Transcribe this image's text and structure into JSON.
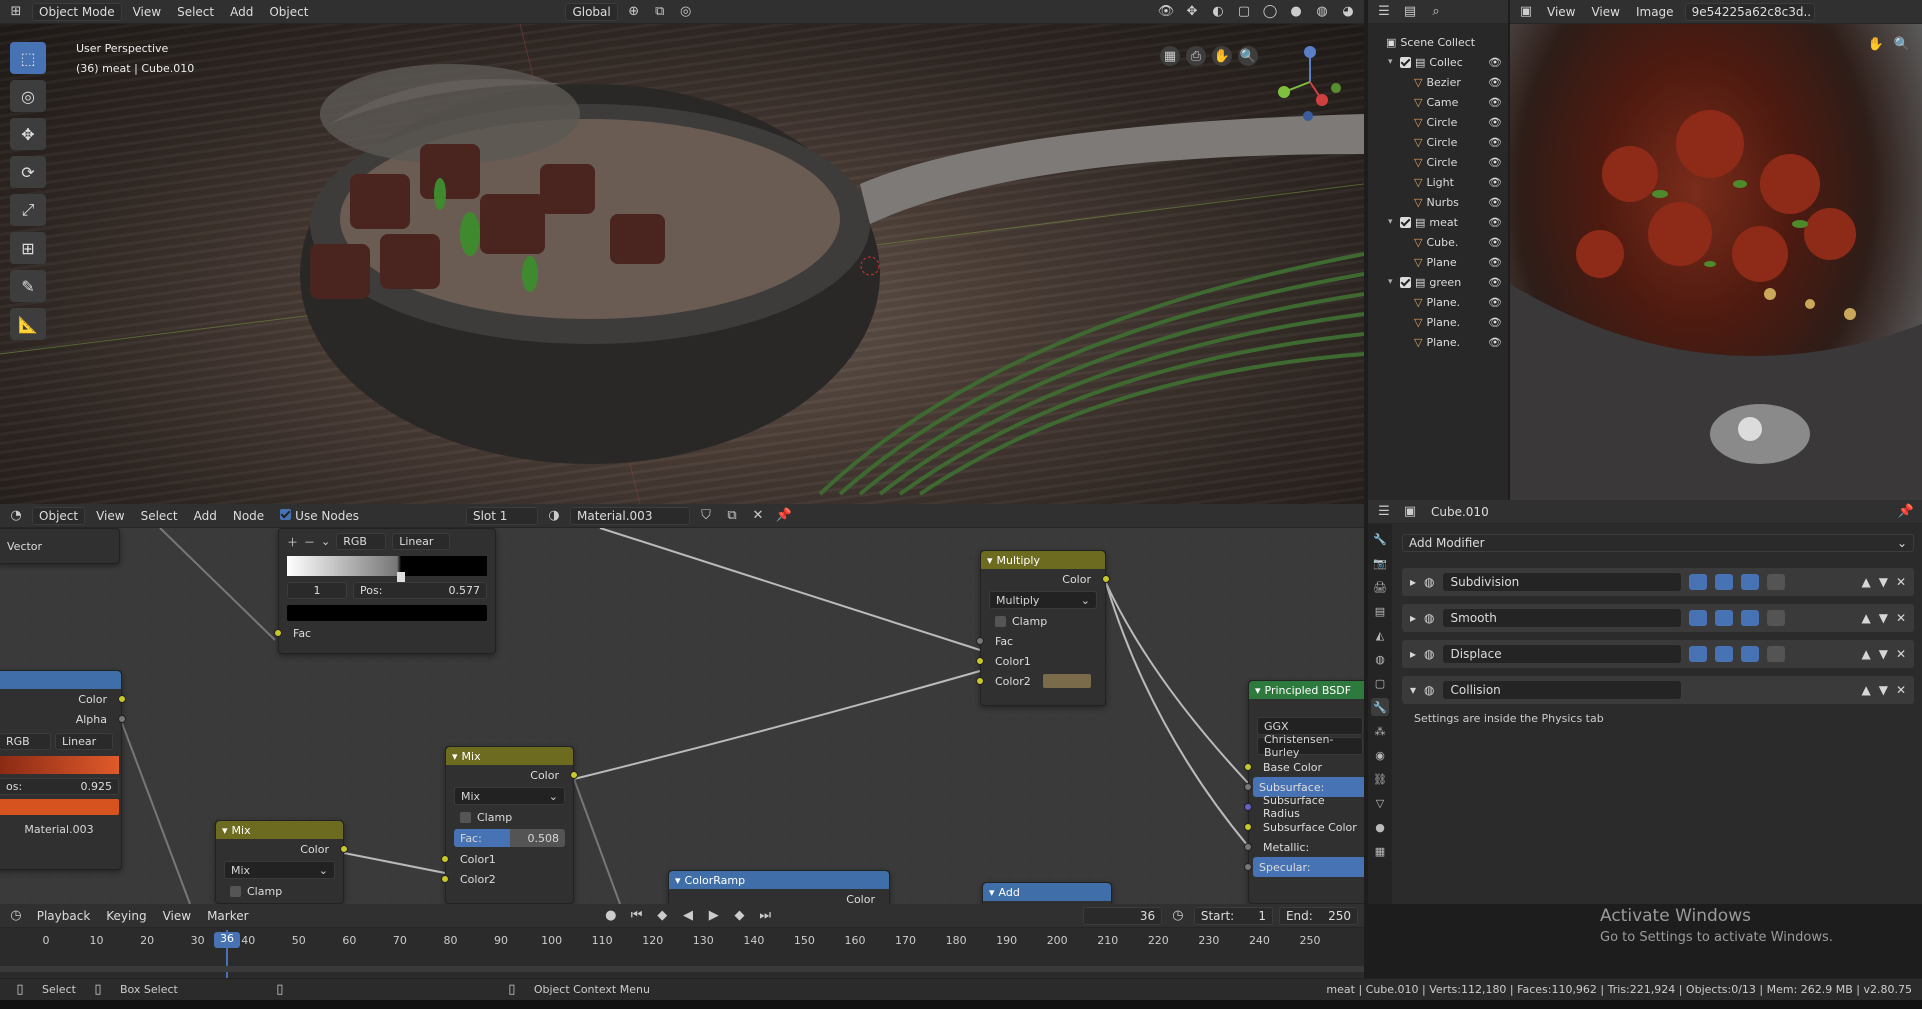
{
  "viewport_header": {
    "mode": "Object Mode",
    "menu": [
      "View",
      "Select",
      "Add",
      "Object"
    ],
    "orientation": "Global"
  },
  "viewport": {
    "perspective": "User Perspective",
    "object_info": "(36) meat | Cube.010"
  },
  "outliner": {
    "rows": [
      {
        "label": "Scene Collect",
        "level": 0
      },
      {
        "label": "Collec",
        "level": 1
      },
      {
        "label": "Bezier",
        "level": 2
      },
      {
        "label": "Came",
        "level": 2
      },
      {
        "label": "Circle",
        "level": 2
      },
      {
        "label": "Circle",
        "level": 2
      },
      {
        "label": "Circle",
        "level": 2
      },
      {
        "label": "Light",
        "level": 2
      },
      {
        "label": "Nurbs",
        "level": 2
      },
      {
        "label": "meat",
        "level": 1
      },
      {
        "label": "Cube.",
        "level": 2
      },
      {
        "label": "Plane",
        "level": 2
      },
      {
        "label": "green",
        "level": 1
      },
      {
        "label": "Plane.",
        "level": 2
      },
      {
        "label": "Plane.",
        "level": 2
      },
      {
        "label": "Plane.",
        "level": 2
      }
    ]
  },
  "image_editor": {
    "menu": [
      "View",
      "View",
      "Image"
    ],
    "image_name": "9e54225a62c8c3d.."
  },
  "node_header": {
    "type": "Object",
    "menu": [
      "View",
      "Select",
      "Add",
      "Node"
    ],
    "use_nodes": "Use Nodes",
    "slot": "Slot 1",
    "material": "Material.003"
  },
  "nodes": {
    "vector_label": "Vector",
    "colorramp1": {
      "mode": "RGB",
      "interp": "Linear",
      "index": "1",
      "pos_label": "Pos:",
      "pos": "0.577",
      "out": "Fac"
    },
    "colorramp2": {
      "out_color": "Color",
      "out_alpha": "Alpha",
      "mode": "RGB",
      "interp": "Linear",
      "pos_label": "os:",
      "pos": "0.925",
      "material": "Material.003"
    },
    "multiply": {
      "title": "Multiply",
      "out": "Color",
      "blend": "Multiply",
      "clamp": "Clamp",
      "in1": "Fac",
      "in2": "Color1",
      "in3": "Color2"
    },
    "mix1": {
      "title": "Mix",
      "out": "Color",
      "blend": "Mix",
      "clamp": "Clamp",
      "fac_label": "Fac:",
      "fac": "0.508",
      "in2": "Color1",
      "in3": "Color2"
    },
    "mix2": {
      "title": "Mix",
      "out": "Color",
      "blend": "Mix",
      "clamp": "Clamp"
    },
    "colorramp3": {
      "title": "ColorRamp",
      "out": "Color"
    },
    "add": {
      "title": "Add"
    },
    "bsdf": {
      "title": "Principled BSDF",
      "dist": "GGX",
      "sss": "Christensen-Burley",
      "rows": [
        "Base Color",
        "Subsurface:",
        "Subsurface Radius",
        "Subsurface Color",
        "Metallic:",
        "Specular:"
      ]
    }
  },
  "props": {
    "object": "Cube.010",
    "add_modifier": "Add Modifier",
    "modifiers": [
      "Subdivision",
      "Smooth",
      "Displace",
      "Collision"
    ],
    "collision_note": "Settings are inside the Physics tab"
  },
  "timeline": {
    "menu": [
      "Playback",
      "Keying",
      "View",
      "Marker"
    ],
    "current": "36",
    "start_label": "Start:",
    "start": "1",
    "end_label": "End:",
    "end": "250",
    "ticks": [
      "0",
      "10",
      "20",
      "30",
      "40",
      "50",
      "60",
      "70",
      "80",
      "90",
      "100",
      "110",
      "120",
      "130",
      "140",
      "150",
      "160",
      "170",
      "180",
      "190",
      "200",
      "210",
      "220",
      "230",
      "240",
      "250"
    ],
    "frame_marker": "36"
  },
  "status": {
    "select": "Select",
    "box_select": "Box Select",
    "context": "Object Context Menu",
    "stats": "meat | Cube.010 | Verts:112,180 | Faces:110,962 | Tris:221,924 | Objects:0/13 | Mem: 262.9 MB | v2.80.75"
  },
  "watermark": {
    "line1": "Activate Windows",
    "line2": "Go to Settings to activate Windows."
  },
  "colors": {
    "accent": "#4772b3",
    "mix_header": "#6d6b1f",
    "conv_header": "#3f6ea8",
    "shader_header": "#2e7a3e"
  }
}
